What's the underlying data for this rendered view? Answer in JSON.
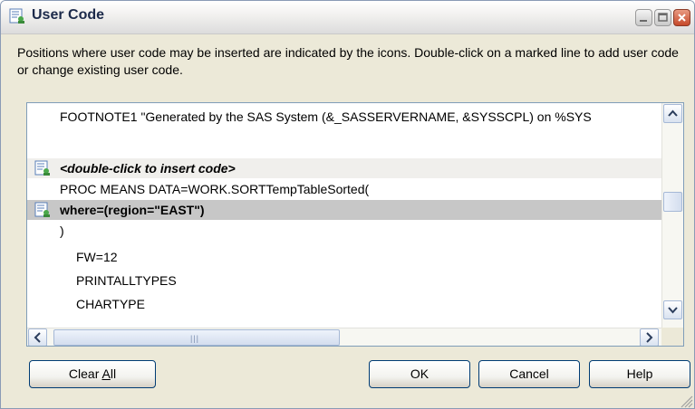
{
  "window": {
    "title": "User Code"
  },
  "description": "Positions where user code may be inserted are indicated by the icons. Double-click on a marked line to add user code or change existing user code.",
  "code_lines": [
    {
      "text": "FOOTNOTE1 \"Generated by the SAS System (&_SASSERVERNAME, &SYSSCPL) on %SYS",
      "style": "normal",
      "marked": false,
      "icon": ""
    },
    {
      "text": "",
      "style": "normal",
      "marked": false,
      "icon": ""
    },
    {
      "text": "<double-click to insert code>",
      "style": "bold-italic",
      "marked": true,
      "icon": "user-code-icon"
    },
    {
      "text": "PROC MEANS DATA=WORK.SORTTempTableSorted(",
      "style": "normal",
      "marked": false,
      "icon": ""
    },
    {
      "text": "where=(region=\"EAST\")",
      "style": "bold",
      "marked": true,
      "selected": true,
      "icon": "user-code-icon"
    },
    {
      "text": ")",
      "style": "normal",
      "marked": false,
      "icon": ""
    },
    {
      "text": "FW=12",
      "style": "indent",
      "marked": false,
      "icon": ""
    },
    {
      "text": "PRINTALLTYPES",
      "style": "indent",
      "marked": false,
      "icon": ""
    },
    {
      "text": "CHARTYPE",
      "style": "indent",
      "marked": false,
      "icon": ""
    }
  ],
  "buttons": {
    "clear_all": "Clear All",
    "clear_all_mnemonic": "A",
    "ok": "OK",
    "cancel": "Cancel",
    "help": "Help"
  },
  "icons": {
    "title": "user-code-icon",
    "minimize": "minimize-icon",
    "maximize": "maximize-icon",
    "close": "close-icon",
    "scroll_up": "arrow-up-icon",
    "scroll_down": "arrow-down-icon",
    "scroll_left": "arrow-left-icon",
    "scroll_right": "arrow-right-icon",
    "resize_grip": "resize-grip-icon"
  },
  "colors": {
    "dialog_background": "#ece9d8",
    "selected_line": "#c7c7c7",
    "button_border": "#003c74"
  }
}
